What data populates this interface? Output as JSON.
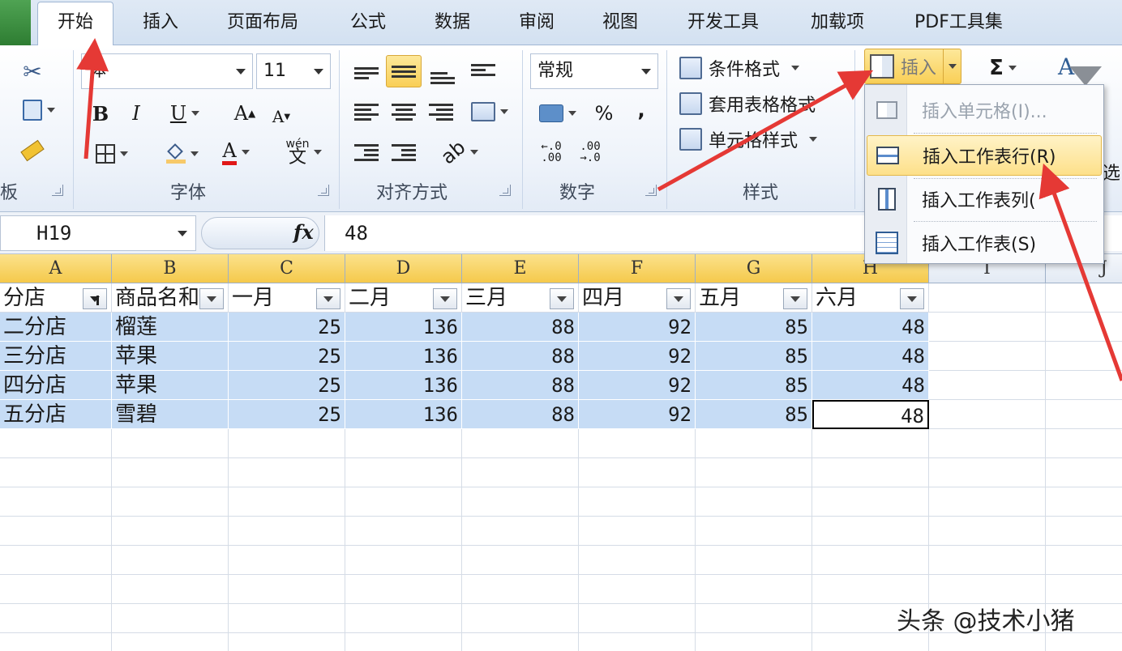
{
  "tabs": {
    "file": "",
    "items": [
      "开始",
      "插入",
      "页面布局",
      "公式",
      "数据",
      "审阅",
      "视图",
      "开发工具",
      "加载项",
      "PDF工具集"
    ]
  },
  "ribbon": {
    "clipboard_label": "板",
    "font": {
      "name": "宋体",
      "name_visible": "体",
      "size": "11",
      "label": "字体"
    },
    "alignment_label": "对齐方式",
    "number": {
      "format": "常规",
      "percent": "%",
      "comma": ",",
      "inc_decimal": "←.0\n.00",
      "dec_decimal": ".00\n→.0",
      "label": "数字"
    },
    "styles": {
      "conditional": "条件格式",
      "table": "套用表格格式",
      "cell": "单元格样式",
      "label": "样式"
    },
    "cells": {
      "insert": "插入"
    },
    "editing": {
      "sum": "Σ",
      "partial": "筛选",
      "partial_visible": "选"
    },
    "font_buttons": {
      "bold": "B",
      "italic": "I",
      "underline": "U",
      "grow": "A",
      "shrink": "A",
      "color": "A",
      "phonetic": "wén"
    }
  },
  "formula_bar": {
    "cell_ref": "H19",
    "fx": "fx",
    "value": "48"
  },
  "grid": {
    "columns": [
      "A",
      "B",
      "C",
      "D",
      "E",
      "F",
      "G",
      "H",
      "I",
      "J"
    ],
    "header_row": [
      "分店",
      "商品名称",
      "一月",
      "二月",
      "三月",
      "四月",
      "五月",
      "六月"
    ],
    "header_row_visible": [
      "分店",
      "商品名和",
      "一月",
      "二月",
      "三月",
      "四月",
      "五月",
      "六月"
    ],
    "rows": [
      [
        "二分店",
        "榴莲",
        "25",
        "136",
        "88",
        "92",
        "85",
        "48"
      ],
      [
        "三分店",
        "苹果",
        "25",
        "136",
        "88",
        "92",
        "85",
        "48"
      ],
      [
        "四分店",
        "苹果",
        "25",
        "136",
        "88",
        "92",
        "85",
        "48"
      ],
      [
        "五分店",
        "雪碧",
        "25",
        "136",
        "88",
        "92",
        "85",
        "48"
      ]
    ]
  },
  "insert_menu": {
    "items": [
      {
        "label": "插入单元格(I)...",
        "disabled": true
      },
      {
        "label": "插入工作表行(R)",
        "hover": true
      },
      {
        "label": "插入工作表列(C)",
        "visible": "插入工作表列("
      },
      {
        "label": "插入工作表(S)"
      }
    ]
  },
  "watermark": "头条 @技术小猪",
  "colors": {
    "ribbon_bg": "#e3ebf6",
    "highlight": "#f9cf56",
    "selection_fill": "#c6dcf5",
    "arrow": "#e53935",
    "file_tab": "#2e7d32"
  }
}
